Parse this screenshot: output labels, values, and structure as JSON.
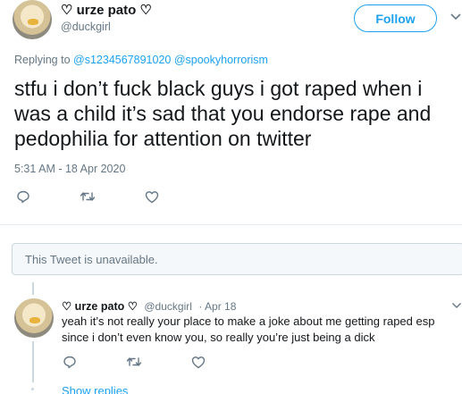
{
  "main_tweet": {
    "name": "♡ urze pato ♡",
    "handle": "@duckgirl",
    "follow_label": "Follow",
    "replying_prefix": "Replying to",
    "replying_to": [
      "@s1234567891020",
      "@spookyhorrorism"
    ],
    "text": "stfu i don’t fuck black guys i got raped when i was a child it’s sad that you endorse rape and pedophilia for attention on twitter",
    "timestamp": "5:31 AM - 18 Apr 2020"
  },
  "unavailable": {
    "text": "This Tweet is unavailable."
  },
  "reply_tweet": {
    "name": "♡ urze pato ♡",
    "handle": "@duckgirl",
    "date": "· Apr 18",
    "text": "yeah it’s not really your place to make a joke about me getting raped esp since i don’t even know you, so really you’re just being a dick",
    "show_replies": "Show replies"
  },
  "icons": {
    "reply": "reply-icon",
    "retweet": "retweet-icon",
    "like": "heart-icon",
    "caret": "chevron-down-icon"
  },
  "colors": {
    "accent": "#1da1f2",
    "muted": "#657786",
    "text": "#14171a",
    "border": "#ccd6dd"
  }
}
